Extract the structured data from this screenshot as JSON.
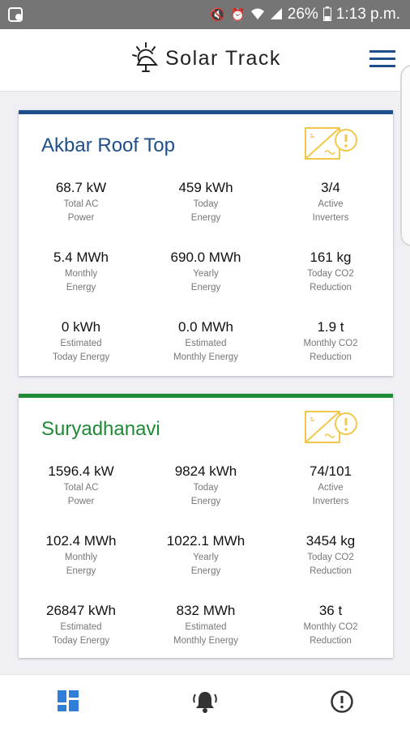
{
  "status": {
    "battery": "26%",
    "time": "1:13 p.m."
  },
  "header": {
    "title": "Solar Track"
  },
  "colors": {
    "navy": "#1f4e8c",
    "green": "#1f8a35",
    "warning": "#f2c84b"
  },
  "sites": [
    {
      "name": "Akbar Roof Top",
      "metrics": [
        {
          "value": "68.7 kW",
          "label": "Total AC\nPower"
        },
        {
          "value": "459 kWh",
          "label": "Today\nEnergy"
        },
        {
          "value": "3/4",
          "label": "Active\nInverters"
        },
        {
          "value": "5.4 MWh",
          "label": "Monthly\nEnergy"
        },
        {
          "value": "690.0 MWh",
          "label": "Yearly\nEnergy"
        },
        {
          "value": "161 kg",
          "label": "Today CO2\nReduction"
        },
        {
          "value": "0 kWh",
          "label": "Estimated\nToday Energy"
        },
        {
          "value": "0.0 MWh",
          "label": "Estimated\nMonthly Energy"
        },
        {
          "value": "1.9 t",
          "label": "Monthly CO2\nReduction"
        }
      ]
    },
    {
      "name": "Suryadhanavi",
      "metrics": [
        {
          "value": "1596.4 kW",
          "label": "Total AC\nPower"
        },
        {
          "value": "9824 kWh",
          "label": "Today\nEnergy"
        },
        {
          "value": "74/101",
          "label": "Active\nInverters"
        },
        {
          "value": "102.4 MWh",
          "label": "Monthly\nEnergy"
        },
        {
          "value": "1022.1 MWh",
          "label": "Yearly\nEnergy"
        },
        {
          "value": "3454 kg",
          "label": "Today CO2\nReduction"
        },
        {
          "value": "26847 kWh",
          "label": "Estimated\nToday Energy"
        },
        {
          "value": "832 MWh",
          "label": "Estimated\nMonthly Energy"
        },
        {
          "value": "36 t",
          "label": "Monthly CO2\nReduction"
        }
      ]
    }
  ],
  "nav": {
    "items": [
      "dashboard-icon",
      "alarm-icon",
      "alert-icon"
    ]
  }
}
